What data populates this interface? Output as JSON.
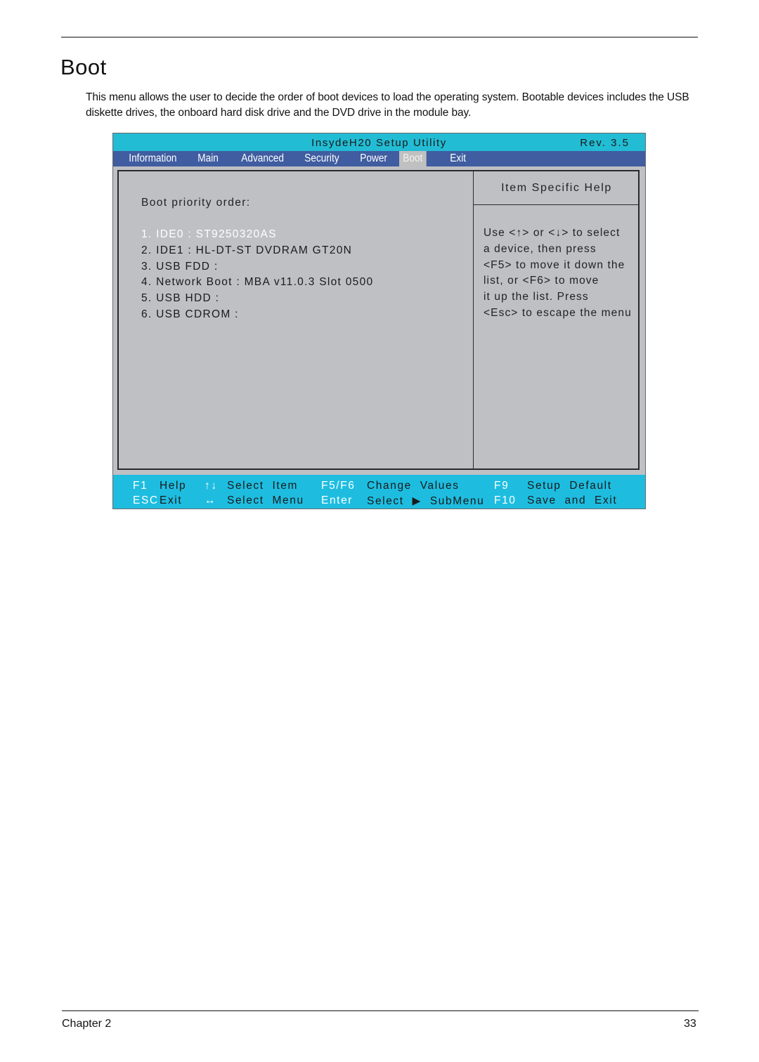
{
  "page": {
    "title": "Boot",
    "intro": "This menu allows the user to decide the order of boot devices to load the operating system. Bootable devices includes the USB diskette drives, the onboard hard disk drive and the DVD drive in the module bay.",
    "footer_chapter": "Chapter 2",
    "footer_page": "33"
  },
  "bios": {
    "title": "InsydeH20 Setup Utility",
    "revision": "Rev. 3.5",
    "colors": {
      "title_bar": "#22bcd4",
      "menu_bar": "#3f5da0",
      "footer_bar": "#1ebde0",
      "panel": "#bfc0c4"
    },
    "menu": [
      {
        "label": "Information",
        "active": false
      },
      {
        "label": "Main",
        "active": false
      },
      {
        "label": "Advanced",
        "active": false
      },
      {
        "label": "Security",
        "active": false
      },
      {
        "label": "Power",
        "active": false
      },
      {
        "label": "Boot",
        "active": true
      },
      {
        "label": "Exit",
        "active": false
      }
    ],
    "boot_label": "Boot priority order:",
    "boot_items": [
      "1. IDE0 : ST9250320AS",
      "2. IDE1 : HL-DT-ST DVDRAM GT20N",
      "3. USB FDD :",
      "4. Network Boot : MBA v11.0.3 Slot 0500",
      "5. USB HDD :",
      "6. USB CDROM :"
    ],
    "selected_index": 0,
    "help_title": "Item Specific Help",
    "help_text": "Use <↑> or <↓> to select\na device, then press\n<F5> to move it down the\nlist, or <F6> to move\nit up the list. Press\n<Esc> to escape the menu",
    "footer": {
      "f1_key": "F1",
      "f1_desc": "Help",
      "updown_key": "↑↓",
      "updown_desc": "Select  Item",
      "f5f6_key": "F5/F6",
      "f5f6_desc": "Change  Values",
      "f9_key": "F9",
      "f9_desc": "Setup  Default",
      "esc_key": "ESC",
      "esc_desc": "Exit",
      "leftright_key": "↔",
      "leftright_desc": "Select  Menu",
      "enter_key": "Enter",
      "enter_desc": "Select  ▶  SubMenu",
      "f10_key": "F10",
      "f10_desc": "Save  and  Exit"
    }
  }
}
